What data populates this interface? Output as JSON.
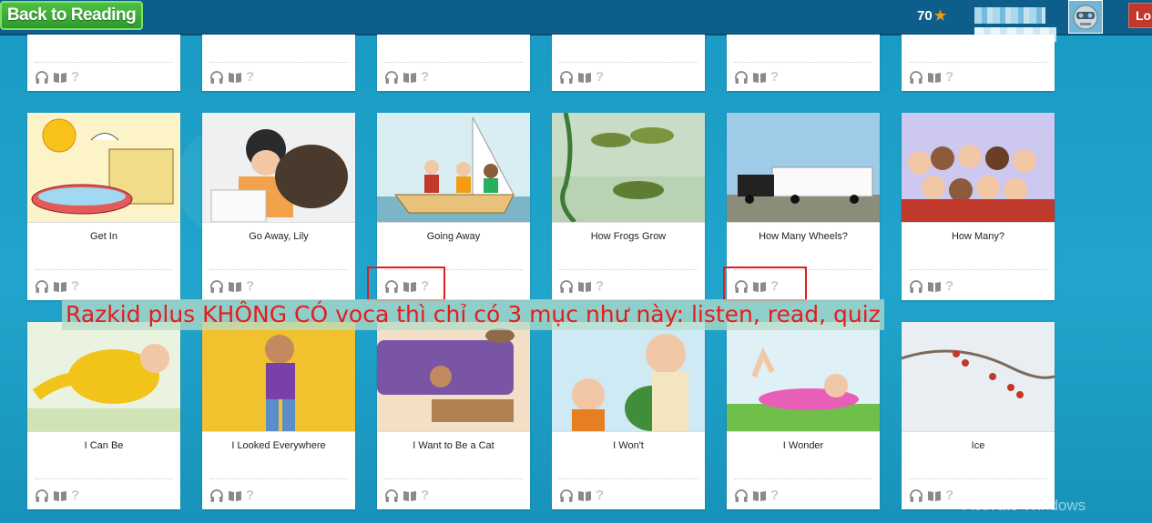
{
  "topbar": {
    "back_label": "Back to Reading",
    "stars": "70",
    "logout_label": "Lo"
  },
  "annotation": "Razkid plus KHÔNG CÓ voca thì chỉ có 3 mục như này: listen, read, quiz",
  "watermark": "Activate Windows",
  "rows": {
    "top": [
      "",
      "",
      "",
      "",
      "",
      ""
    ],
    "middle": [
      "Get In",
      "Go Away, Lily",
      "Going Away",
      "How Frogs Grow",
      "How Many Wheels?",
      "How Many?"
    ],
    "bottom": [
      "I Can Be",
      "I Looked Everywhere",
      "I Want to Be a Cat",
      "I Won't",
      "I Wonder",
      "Ice"
    ]
  },
  "colors": {
    "accent_green": "#3aae34",
    "topbar": "#0d5e8a",
    "annotation_text": "#e81b1b",
    "background": "#1f9cc2"
  }
}
